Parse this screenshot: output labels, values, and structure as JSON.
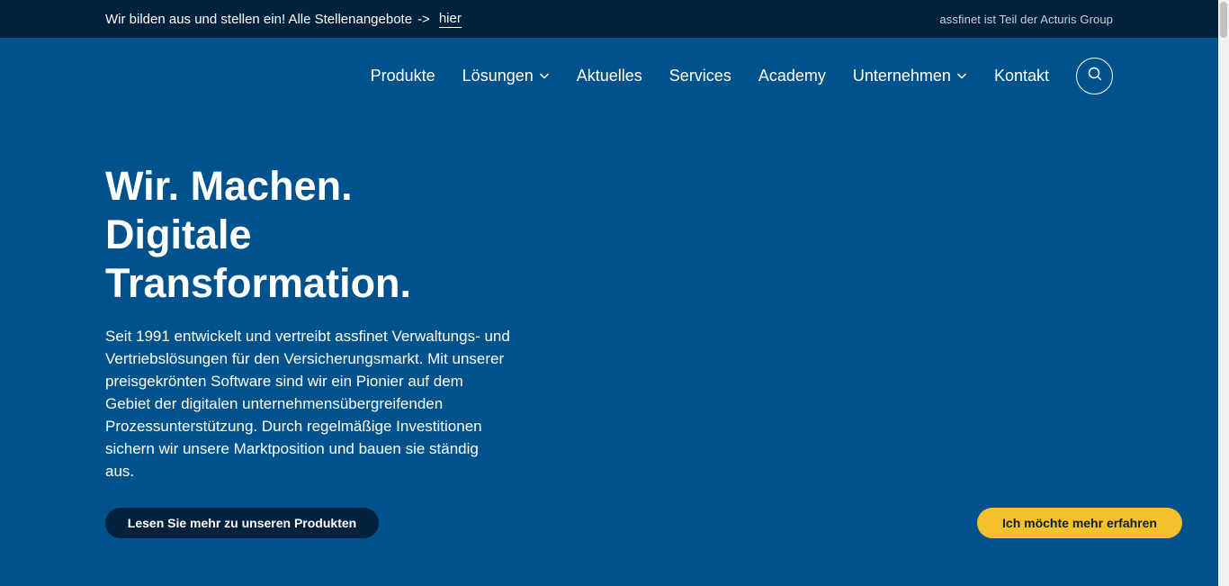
{
  "topbar": {
    "jobs_text": "Wir bilden aus und stellen ein! Alle Stellenangebote",
    "arrow": "->",
    "jobs_link": "hier",
    "group_text": "assfinet ist Teil der Acturis Group"
  },
  "nav": {
    "items": [
      {
        "label": "Produkte"
      },
      {
        "label": "Lösungen"
      },
      {
        "label": "Aktuelles"
      },
      {
        "label": "Services"
      },
      {
        "label": "Academy"
      },
      {
        "label": "Unternehmen"
      },
      {
        "label": "Kontakt"
      }
    ],
    "search_icon": "search-icon",
    "chevron_icon": "chevron-down-icon"
  },
  "hero": {
    "title_lines": [
      "Wir. Machen.",
      "Digitale",
      "Transformation."
    ],
    "text": "Seit 1991 entwickelt und vertreibt assfinet Verwaltungs- und Vertriebslösungen für den Versicherungsmarkt. Mit unserer preisgekrönten Software sind wir ein Pionier auf dem Gebiet der digitalen unternehmensübergreifenden Prozessunterstützung. Durch regelmäßige Investitionen sichern wir unsere Marktposition und bauen sie ständig aus."
  },
  "buttons": {
    "products": "Lesen Sie mehr zu unseren Produkten",
    "learn_more": "Ich möchte mehr erfahren"
  },
  "colors": {
    "background": "#00528c",
    "topbar": "#02213d",
    "accent_yellow": "#f4c12b"
  }
}
